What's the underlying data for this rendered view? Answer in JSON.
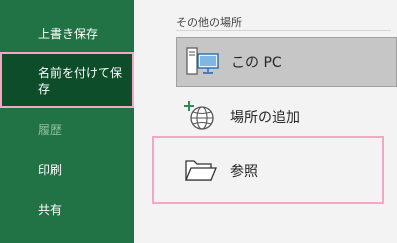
{
  "nav": {
    "items": [
      {
        "label": "上書き保存",
        "state": "normal"
      },
      {
        "label": "名前を付けて保存",
        "state": "selected"
      },
      {
        "label": "履歴",
        "state": "disabled"
      },
      {
        "label": "印刷",
        "state": "normal"
      },
      {
        "label": "共有",
        "state": "normal"
      }
    ]
  },
  "main": {
    "section_title": "その他の場所",
    "locations": [
      {
        "label": "この PC",
        "icon": "pc-icon"
      },
      {
        "label": "場所の追加",
        "icon": "add-place-globe-icon"
      },
      {
        "label": "参照",
        "icon": "folder-icon"
      }
    ]
  },
  "colors": {
    "nav_bg": "#217346",
    "nav_selected_bg": "#0e4d2a",
    "highlight": "#f3a6c6"
  }
}
